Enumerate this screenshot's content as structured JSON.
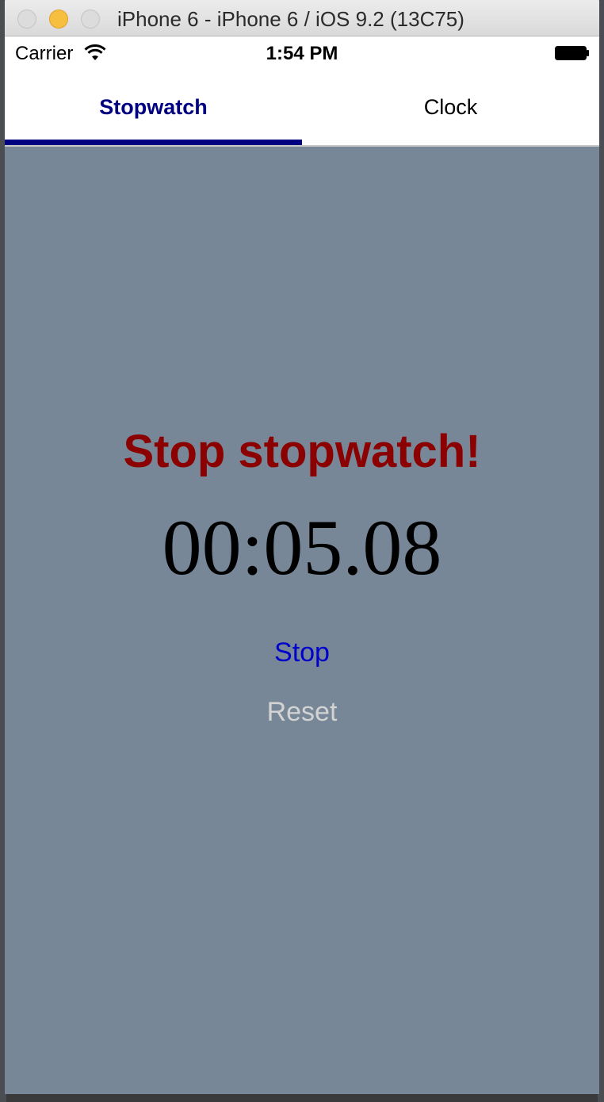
{
  "window": {
    "title": "iPhone 6 - iPhone 6 / iOS 9.2 (13C75)"
  },
  "status_bar": {
    "carrier": "Carrier",
    "time": "1:54 PM",
    "icons": [
      "wifi-icon",
      "battery-icon"
    ]
  },
  "tabs": [
    {
      "label": "Stopwatch",
      "active": true
    },
    {
      "label": "Clock",
      "active": false
    }
  ],
  "stopwatch": {
    "heading": "Stop stopwatch!",
    "elapsed": "00:05.08",
    "stop_label": "Stop",
    "reset_label": "Reset"
  },
  "colors": {
    "accent": "#000080",
    "heading": "#8b0000",
    "background": "#778797",
    "stop_button": "#0000cc",
    "reset_button": "#d3d3d3"
  }
}
